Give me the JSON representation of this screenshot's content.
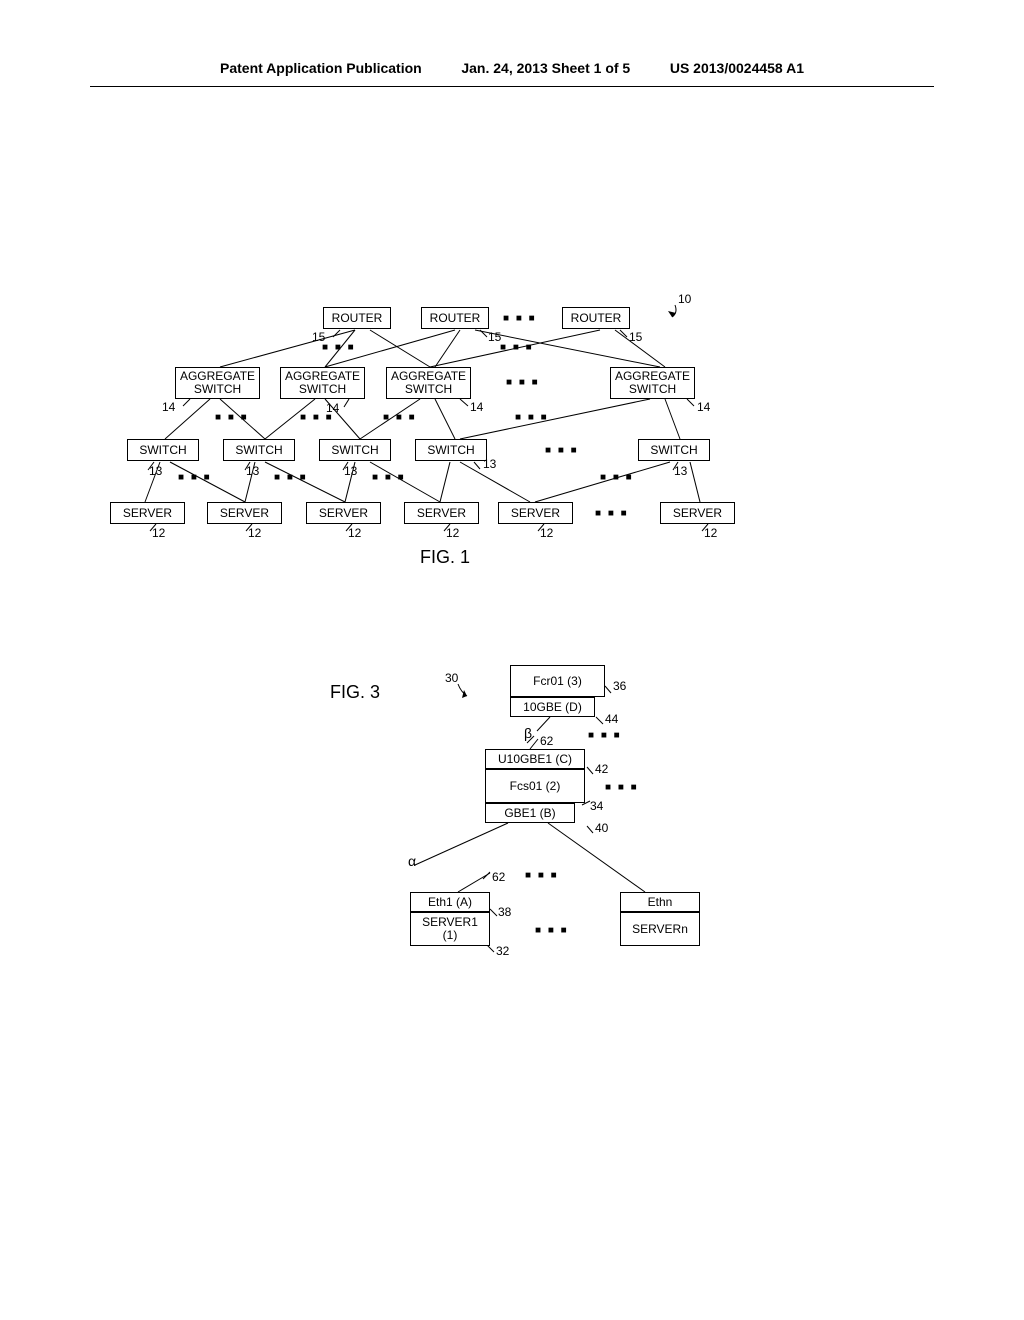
{
  "header": {
    "left": "Patent Application Publication",
    "center": "Jan. 24, 2013  Sheet 1 of 5",
    "right": "US 2013/0024458 A1"
  },
  "fig1": {
    "label": "FIG. 1",
    "ref10": "10",
    "routers": {
      "label": "ROUTER",
      "ref": "15"
    },
    "agg": {
      "label1": "AGGREGATE",
      "label2": "SWITCH",
      "ref": "14"
    },
    "switch": {
      "label": "SWITCH",
      "ref": "13"
    },
    "server": {
      "label": "SERVER",
      "ref": "12"
    },
    "dots": "■ ■ ■"
  },
  "fig3": {
    "label": "FIG. 3",
    "ref30": "30",
    "fcr01": "Fcr01 (3)",
    "ref36": "36",
    "gbe10": "10GBE (D)",
    "ref44": "44",
    "beta": "β",
    "ref62a": "62",
    "u10gbe1": "U10GBE1 (C)",
    "ref42": "42",
    "fcs01": "Fcs01 (2)",
    "ref34": "34",
    "gbe1": "GBE1 (B)",
    "ref40": "40",
    "alpha": "α",
    "ref62b": "62",
    "eth1": "Eth1 (A)",
    "ref38": "38",
    "server1a": "SERVER1",
    "server1b": "(1)",
    "ref32": "32",
    "ethn": "Ethn",
    "servern": "SERVERn",
    "dots": "■ ■ ■"
  }
}
